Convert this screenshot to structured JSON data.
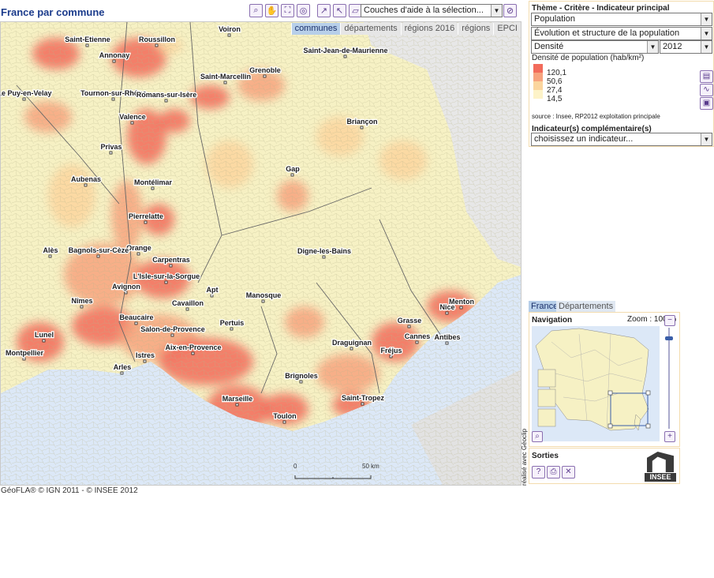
{
  "title": "France par commune",
  "toolbar": {
    "tools": [
      "zoom-icon",
      "pan-hand-icon",
      "fullscreen-icon",
      "binoculars-icon",
      "select-point-icon",
      "select-line-icon",
      "select-shape-icon"
    ],
    "layers_select": "Couches d'aide à la sélection...",
    "clear_tool": "erase-selection-icon"
  },
  "map_tabs": [
    "communes",
    "départements",
    "régions 2016",
    "régions",
    "EPCI"
  ],
  "map_tab_active": "communes",
  "cities": [
    "Voiron",
    "Saint-Etienne",
    "Roussillon",
    "Saint-Jean-de-Maurienne",
    "Annonay",
    "Grenoble",
    "Saint-Marcellin",
    "Le Puy-en-Velay",
    "Tournon-sur-Rhône",
    "Romans-sur-Isère",
    "Valence",
    "Briançon",
    "Privas",
    "Gap",
    "Aubenas",
    "Montélimar",
    "Pierrelatte",
    "Digne-les-Bains",
    "Orange",
    "Alès",
    "Bagnols-sur-Cèze",
    "Carpentras",
    "L'Isle-sur-la-Sorgue",
    "Avignon",
    "Apt",
    "Nîmes",
    "Cavaillon",
    "Manosque",
    "Nice",
    "Menton",
    "Beaucaire",
    "Grasse",
    "Lunel",
    "Salon-de-Provence",
    "Pertuis",
    "Antibes",
    "Cannes",
    "Montpellier",
    "Draguignan",
    "Aix-en-Provence",
    "Istres",
    "Fréjus",
    "Arles",
    "Brignoles",
    "Marseille",
    "Saint-Tropez",
    "Toulon"
  ],
  "scale": {
    "zero": "0",
    "end": "50 km"
  },
  "footer": "GéoFLA® © IGN 2011 - © INSEE 2012",
  "credit_vertical": "réalisé avec Géoclip",
  "panel": {
    "header": "Thème - Critère - Indicateur principal",
    "theme": "Population",
    "critere": "Évolution et structure de la population",
    "indicator": "Densité",
    "year": "2012",
    "legend_title": "Densité de population (hab/km²)",
    "legend_values": [
      "120,1",
      "50,6",
      "27,4",
      "14,5"
    ],
    "legend_colors": [
      "#f26b5b",
      "#f7a37e",
      "#fbd59e",
      "#fdf3c8"
    ],
    "source": "source : Insee, RP2012 exploitation principale",
    "complement_title": "Indicateur(s) complémentaire(s)",
    "complement_select": "choisissez un indicateur..."
  },
  "nav": {
    "tab_france": "France",
    "tab_departements": "Départements",
    "title": "Navigation",
    "zoom": "Zoom : 100 %"
  },
  "sorties": {
    "title": "Sorties",
    "logo": "INSEE"
  }
}
